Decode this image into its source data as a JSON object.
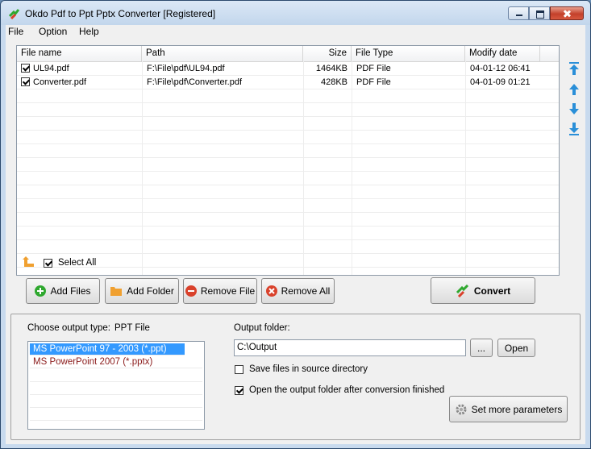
{
  "window": {
    "title": "Okdo Pdf to Ppt Pptx Converter [Registered]"
  },
  "menu": [
    "File",
    "Option",
    "Help"
  ],
  "file_list": {
    "columns": [
      "File name",
      "Path",
      "Size",
      "File Type",
      "Modify date"
    ],
    "rows": [
      {
        "checked": true,
        "name": "UL94.pdf",
        "path": "F:\\File\\pdf\\UL94.pdf",
        "size": "1464KB",
        "type": "PDF File",
        "date": "04-01-12 06:41"
      },
      {
        "checked": true,
        "name": "Converter.pdf",
        "path": "F:\\File\\pdf\\Converter.pdf",
        "size": "428KB",
        "type": "PDF File",
        "date": "04-01-09 01:21"
      }
    ]
  },
  "select_all": {
    "label": "Select All",
    "checked": true
  },
  "buttons": {
    "add_files": "Add Files",
    "add_folder": "Add Folder",
    "remove_file": "Remove File",
    "remove_all": "Remove All",
    "convert": "Convert"
  },
  "output": {
    "type_label": "Choose output type:",
    "type_value": "PPT File",
    "types": [
      "MS PowerPoint 97 - 2003 (*.ppt)",
      "MS PowerPoint 2007 (*.pptx)"
    ],
    "folder_label": "Output folder:",
    "folder_value": "C:\\Output",
    "browse_label": "...",
    "open_label": "Open",
    "save_in_source": {
      "label": "Save files in source directory",
      "checked": false
    },
    "open_after": {
      "label": "Open the output folder after conversion finished",
      "checked": true
    },
    "more_params": "Set more parameters"
  },
  "colors": {
    "accent": "#3399ff",
    "add_green": "#2fa82f",
    "remove_red": "#d9412b",
    "folder_orange": "#f0a030",
    "arrow_blue": "#2a8fd8"
  }
}
